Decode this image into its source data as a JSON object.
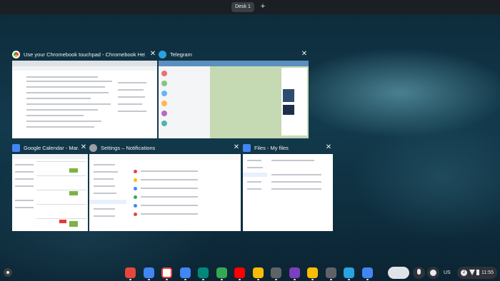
{
  "topbar": {
    "desk_label": "Desk 1",
    "add_desk": "+"
  },
  "windows": [
    {
      "title": "Use your Chromebook touchpad - Chromebook Help",
      "close": "✕",
      "icon_color": "#ffffff"
    },
    {
      "title": "Telegram",
      "close": "✕",
      "icon_color": "#2aa3df"
    },
    {
      "title": "Google Calendar - Mar...",
      "close": "✕",
      "icon_color": "#4285f4"
    },
    {
      "title": "Settings – Notifications",
      "close": "✕",
      "icon_color": "#5f6368"
    },
    {
      "title": "Files - My files",
      "close": "✕",
      "icon_color": "#4285f4"
    }
  ],
  "shelf": {
    "apps": [
      {
        "name": "chrome-icon",
        "color": "#e8453c"
      },
      {
        "name": "docs-icon",
        "color": "#4285f4"
      },
      {
        "name": "gmail-icon",
        "color": "#ffffff"
      },
      {
        "name": "files-icon",
        "color": "#4285f4"
      },
      {
        "name": "meet-icon",
        "color": "#00897b"
      },
      {
        "name": "play-store-icon",
        "color": "#34a853"
      },
      {
        "name": "youtube-icon",
        "color": "#ff0000"
      },
      {
        "name": "photos-icon",
        "color": "#fbbc04"
      },
      {
        "name": "camera-icon",
        "color": "#5f6368"
      },
      {
        "name": "onenote-icon",
        "color": "#7b3fbf"
      },
      {
        "name": "keep-icon",
        "color": "#fbbc04"
      },
      {
        "name": "settings-icon",
        "color": "#5f6368"
      },
      {
        "name": "telegram-icon",
        "color": "#2aa3df"
      },
      {
        "name": "calendar-icon",
        "color": "#4285f4"
      }
    ],
    "tray": {
      "keyboard_layout": "US",
      "network_badge": "2",
      "time": "11:55"
    }
  }
}
